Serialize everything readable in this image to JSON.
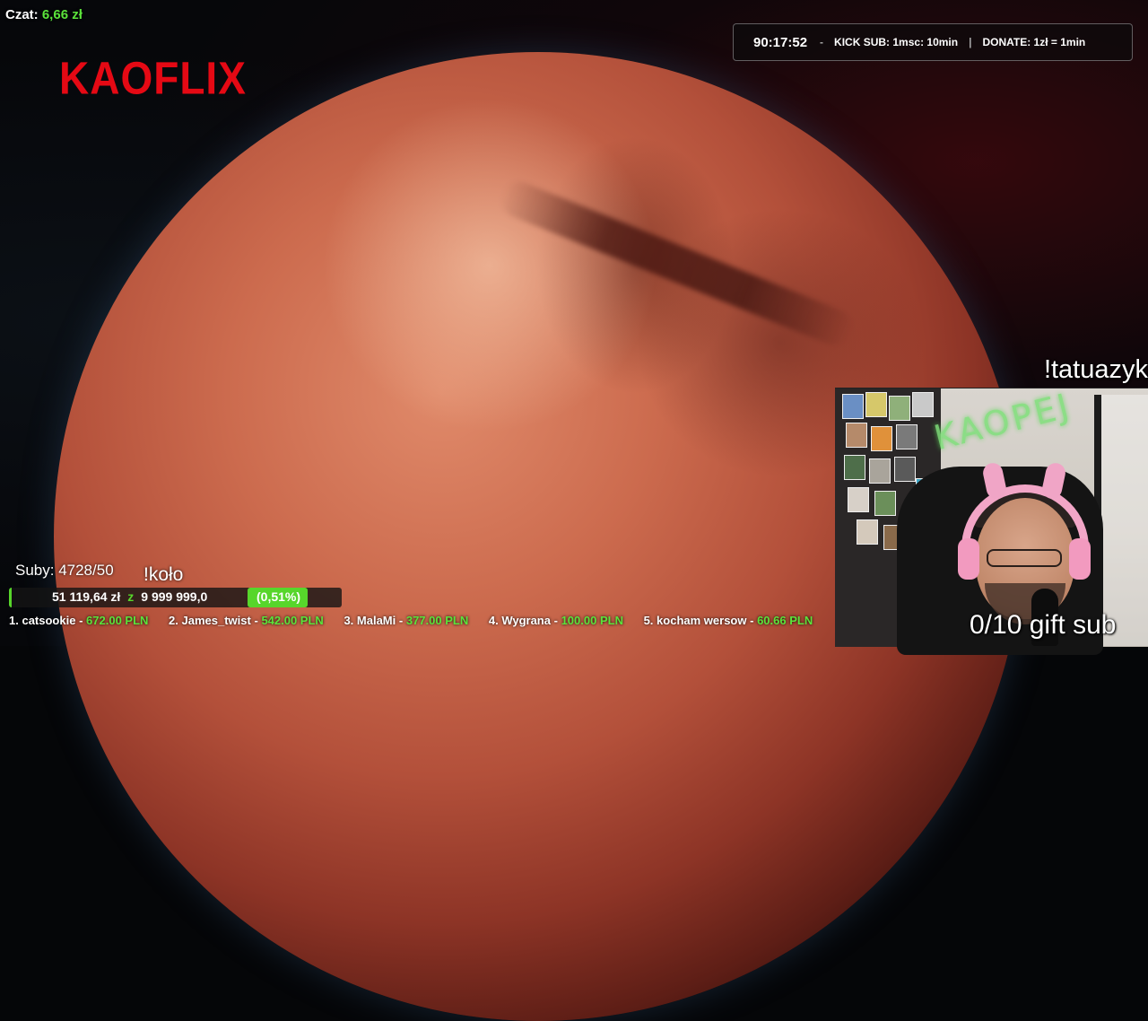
{
  "overlay": {
    "chat": {
      "label": "Czat:",
      "value": "6,66 zł"
    },
    "logo": "KAOFLIX",
    "topbar": {
      "timer": "90:17:52",
      "separator": "-",
      "kick_sub": "KICK SUB: 1msc: 10min",
      "divider": "|",
      "donate": "DONATE: 1zł = 1min"
    },
    "commands": {
      "tatuazyk": "!tatuazyk",
      "kolo": "!koło"
    },
    "webcam": {
      "neon_sign": "KAOPEJ"
    },
    "gift_sub": "0/10 gift sub",
    "subs": "Suby: 4728/50",
    "goal": {
      "current": "51 119,64 zł",
      "z": "z",
      "target": "9 999 999,0",
      "percent": "(0,51%)",
      "progress_fraction": 0.0051
    },
    "leaderboard": [
      {
        "rank": "1.",
        "name": "catsookie",
        "amount": "672.00 PLN"
      },
      {
        "rank": "2.",
        "name": "James_twist",
        "amount": "542.00 PLN"
      },
      {
        "rank": "3.",
        "name": "MalaMi",
        "amount": "377.00 PLN"
      },
      {
        "rank": "4.",
        "name": "Wygrana",
        "amount": "100.00 PLN"
      },
      {
        "rank": "5.",
        "name": "kocham wersow",
        "amount": "60.66 PLN"
      }
    ],
    "leaderboard_sep": "-"
  },
  "colors": {
    "accent_green": "#5be33b",
    "logo_red": "#e50914",
    "planet": "#c4603f"
  }
}
